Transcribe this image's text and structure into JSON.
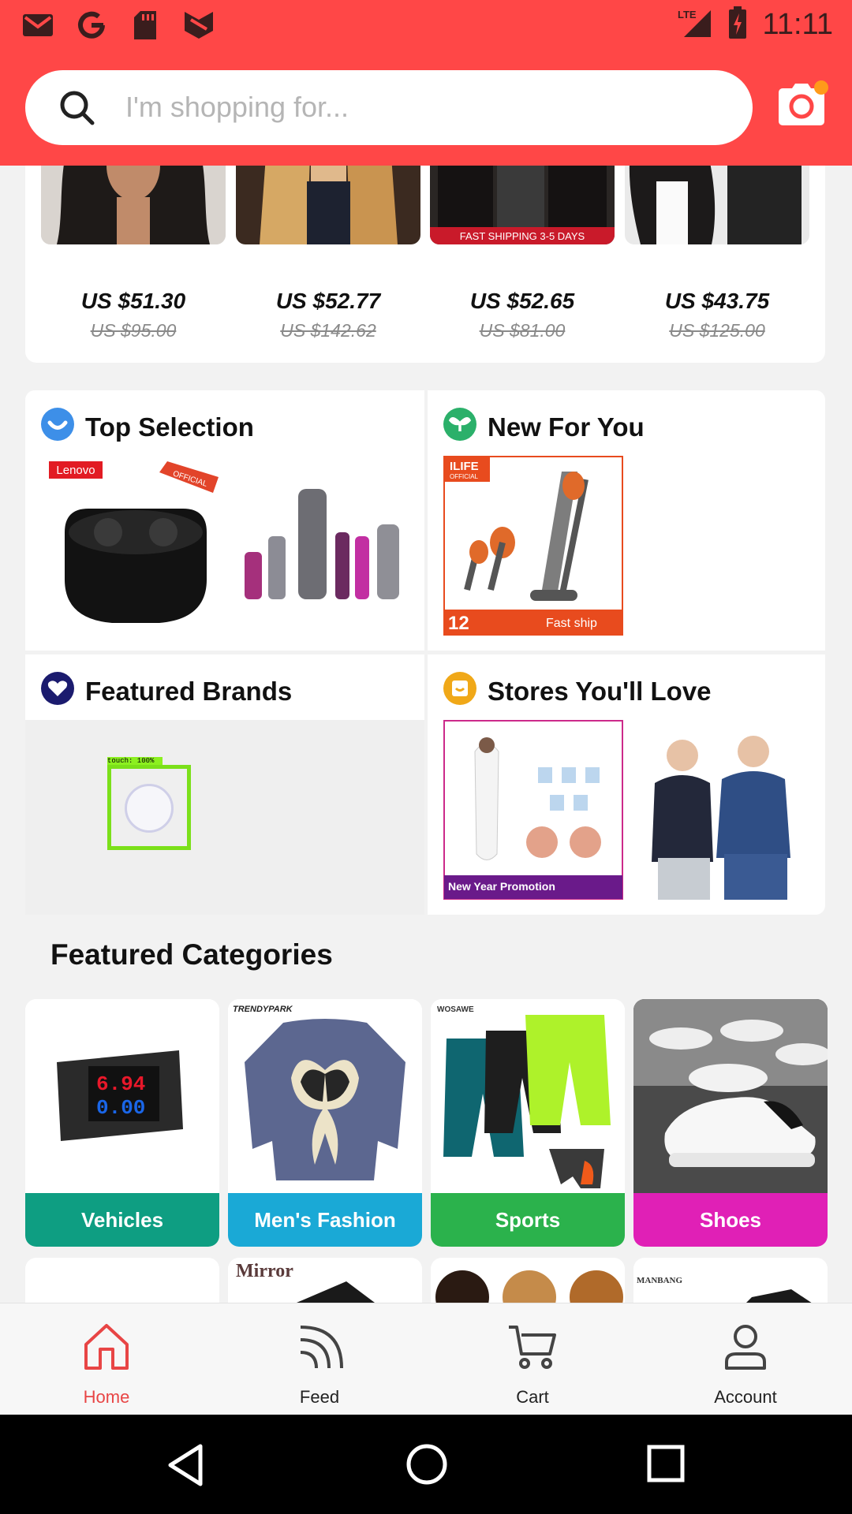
{
  "status_bar": {
    "time": "11:11",
    "network": "LTE",
    "app_icons": [
      "gmail-icon",
      "google-icon",
      "sd-card-icon",
      "news-icon"
    ]
  },
  "search": {
    "placeholder": "I'm shopping for..."
  },
  "deals": [
    {
      "price": "US $51.30",
      "original": "US $95.00"
    },
    {
      "price": "US $52.77",
      "original": "US $142.62"
    },
    {
      "price": "US $52.65",
      "original": "US $81.00"
    },
    {
      "price": "US $43.75",
      "original": "US $125.00"
    }
  ],
  "deal_banner": "FAST SHIPPING 3-5 DAYS",
  "tiles": {
    "top_selection": {
      "title": "Top Selection",
      "badge": "Lenovo",
      "ribbon": "OFFICIAL"
    },
    "new_for_you": {
      "title": "New For You",
      "brand": "ILIFE",
      "brand_sub": "OFFICIAL",
      "warranty": "12",
      "ship": "Fast ship"
    },
    "featured_brands": {
      "title": "Featured Brands",
      "touch": "touch: 100%"
    },
    "stores": {
      "title": "Stores You'll Love",
      "promo": "New Year Promotion"
    }
  },
  "featured_categories": {
    "title": "Featured Categories",
    "items": [
      {
        "label": "Vehicles",
        "color": "#0e9e82",
        "meter_top": "6.94",
        "meter_bottom": "0.00"
      },
      {
        "label": "Men's Fashion",
        "color": "#1aa9d6",
        "brand": "TRENDYPARK"
      },
      {
        "label": "Sports",
        "color": "#2bb24c",
        "brand": "WOSAWE"
      },
      {
        "label": "Shoes",
        "color": "#e020b6"
      }
    ],
    "peek_brands": [
      "Mirror",
      "MANBANG"
    ]
  },
  "bottom_nav": [
    {
      "label": "Home",
      "icon": "home-icon",
      "active": true
    },
    {
      "label": "Feed",
      "icon": "feed-icon",
      "active": false
    },
    {
      "label": "Cart",
      "icon": "cart-icon",
      "active": false
    },
    {
      "label": "Account",
      "icon": "account-icon",
      "active": false
    }
  ],
  "colors": {
    "brand": "#ff4747",
    "active_nav": "#e84545"
  }
}
